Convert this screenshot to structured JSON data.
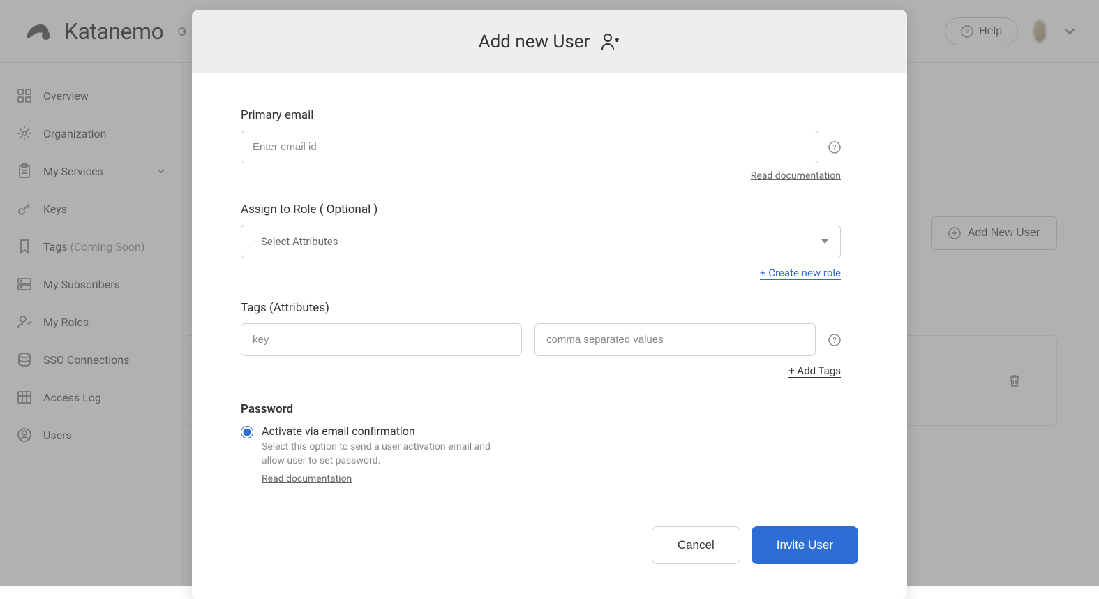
{
  "header": {
    "logo_text": "Katanemo",
    "help_label": "Help"
  },
  "sidebar": {
    "items": [
      {
        "label": "Overview"
      },
      {
        "label": "Organization"
      },
      {
        "label": "My Services"
      },
      {
        "label": "Keys"
      },
      {
        "label": "Tags",
        "suffix": "(Coming Soon)"
      },
      {
        "label": "My Subscribers"
      },
      {
        "label": "My Roles"
      },
      {
        "label": "SSO Connections"
      },
      {
        "label": "Access Log"
      },
      {
        "label": "Users"
      }
    ]
  },
  "main": {
    "add_user_btn": "Add New User"
  },
  "modal": {
    "title": "Add new User",
    "primary_email": {
      "label": "Primary email",
      "placeholder": "Enter email id",
      "doc_link": "Read documentation"
    },
    "role": {
      "label": "Assign to Role ( Optional )",
      "placeholder": "-- Select Attributes--",
      "create_link": "+ Create new role"
    },
    "tags": {
      "label": "Tags (Attributes)",
      "key_placeholder": "key",
      "value_placeholder": "comma separated values",
      "add_link": "+ Add Tags"
    },
    "password": {
      "label": "Password",
      "option_label": "Activate via email confirmation",
      "option_desc": "Select this option to send a user activation email and allow user to set password.",
      "doc_link": "Read documentation"
    },
    "cancel_btn": "Cancel",
    "invite_btn": "Invite User"
  }
}
